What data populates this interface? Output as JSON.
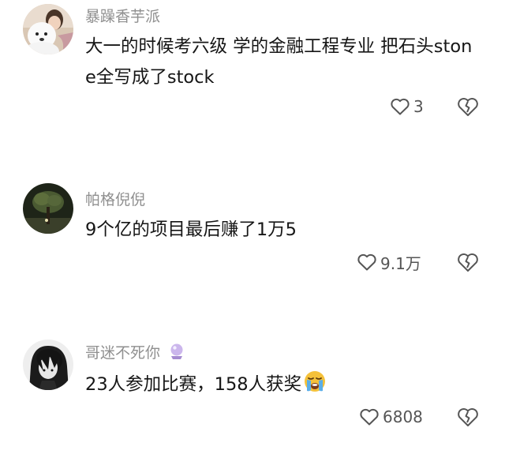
{
  "comments": [
    {
      "username": "暴躁香芋派",
      "text": "大一的时候考六级 学的金融工程专业 把石头stone全写成了stock",
      "like_count": "3",
      "avatar_icon": "dog-with-person-avatar",
      "name_emoji": null,
      "text_emoji": null
    },
    {
      "username": "帕格倪倪",
      "text": "9个亿的项目最后赚了1万5",
      "like_count": "9.1万",
      "avatar_icon": "tree-at-night-avatar",
      "name_emoji": null,
      "text_emoji": null
    },
    {
      "username": "哥迷不死你",
      "text": "23人参加比赛，158人获奖",
      "like_count": "6808",
      "avatar_icon": "dark-hair-character-avatar",
      "name_emoji": "crystal-ball-icon",
      "text_emoji": "loudly-crying-face-icon"
    }
  ],
  "colors": {
    "username": "#8f8f8f",
    "text": "#161616",
    "icon_stroke": "#555555",
    "emoji_face": "#f5c13a",
    "emoji_tears": "#5aaee8"
  }
}
